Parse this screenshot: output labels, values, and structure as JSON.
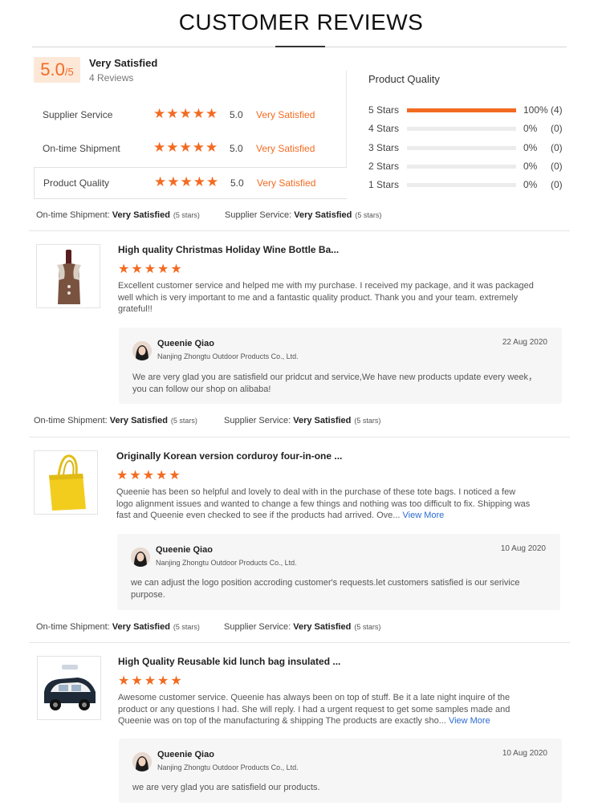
{
  "header": {
    "title": "CUSTOMER REVIEWS"
  },
  "summary": {
    "score": "5.0",
    "score_suffix": "/5",
    "label": "Very Satisfied",
    "review_count": "4 Reviews"
  },
  "metrics": [
    {
      "name": "Supplier Service",
      "stars": "★★★★★",
      "score": "5.0",
      "label": "Very Satisfied"
    },
    {
      "name": "On-time Shipment",
      "stars": "★★★★★",
      "score": "5.0",
      "label": "Very Satisfied"
    },
    {
      "name": "Product Quality",
      "stars": "★★★★★",
      "score": "5.0",
      "label": "Very Satisfied"
    }
  ],
  "distribution": {
    "title": "Product Quality",
    "rows": [
      {
        "label": "5 Stars",
        "fill": 1.0,
        "pct": "100%",
        "count": "(4)"
      },
      {
        "label": "4 Stars",
        "fill": 0,
        "pct": "0%",
        "count": "(0)"
      },
      {
        "label": "3 Stars",
        "fill": 0,
        "pct": "0%",
        "count": "(0)"
      },
      {
        "label": "2 Stars",
        "fill": 0,
        "pct": "0%",
        "count": "(0)"
      },
      {
        "label": "1 Stars",
        "fill": 0,
        "pct": "0%",
        "count": "(0)"
      }
    ]
  },
  "sub_labels": {
    "shipment": "On-time Shipment:",
    "service": "Supplier Service:",
    "value": "Very Satisfied",
    "stars": "(5 stars)"
  },
  "reviews": [
    {
      "title": "High quality Christmas Holiday Wine Bottle Ba...",
      "stars": "★★★★★",
      "body": "Excellent customer service and helped me with my purchase.  I received my package, and it was packaged well which is very important to me and a fantastic quality product.  Thank you and your team.  extremely grateful!!",
      "more": "",
      "reply": {
        "name": "Queenie Qiao",
        "company": "Nanjing Zhongtu Outdoor Products Co., Ltd.",
        "date": "22 Aug 2020",
        "text": "We are very glad you are satisfield our pridcut and service,We have new products update every week，you can follow our shop on alibaba!"
      }
    },
    {
      "title": "Originally Korean version corduroy four-in-one ...",
      "stars": "★★★★★",
      "body": "Queenie has been so helpful and lovely to deal with in the purchase of these tote bags. I noticed a few logo alignment issues and wanted to change a few things and nothing was too difficult to fix. Shipping was fast and Queenie even checked to see if the products had arrived. Ove... ",
      "more": "View More",
      "reply": {
        "name": "Queenie Qiao",
        "company": "Nanjing Zhongtu Outdoor Products Co., Ltd.",
        "date": "10 Aug 2020",
        "text": "we can adjust the logo position accroding customer's requests.let customers satisfied is our serivice purpose."
      }
    },
    {
      "title": "High Quality Reusable kid lunch bag insulated ...",
      "stars": "★★★★★",
      "body": "Awesome customer service. Queenie has always been on top of stuff. Be it a late night inquire of the product or any questions I had. She will reply. I had a urgent request to get some samples made and Queenie was on top of the manufacturing & shipping The products are exactly sho... ",
      "more": "View More",
      "reply": {
        "name": "Queenie Qiao",
        "company": "Nanjing Zhongtu Outdoor Products Co., Ltd.",
        "date": "10 Aug 2020",
        "text": "we are very glad you are satisfield our products."
      }
    }
  ]
}
